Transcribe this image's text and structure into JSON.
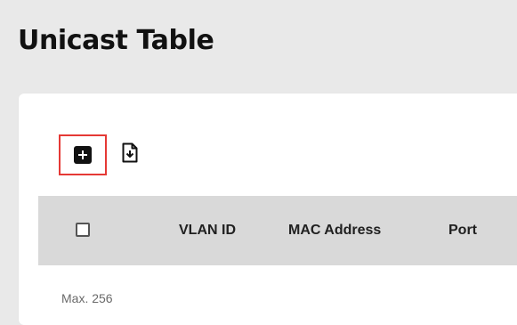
{
  "page": {
    "title": "Unicast Table"
  },
  "toolbar": {
    "add_icon": "add-box-icon",
    "export_icon": "file-download-icon",
    "highlight_color": "#e53935"
  },
  "table": {
    "columns": [
      "VLAN ID",
      "MAC Address",
      "Port"
    ],
    "select_all_checked": false,
    "rows": []
  },
  "footer": {
    "max_label": "Max. 256"
  }
}
